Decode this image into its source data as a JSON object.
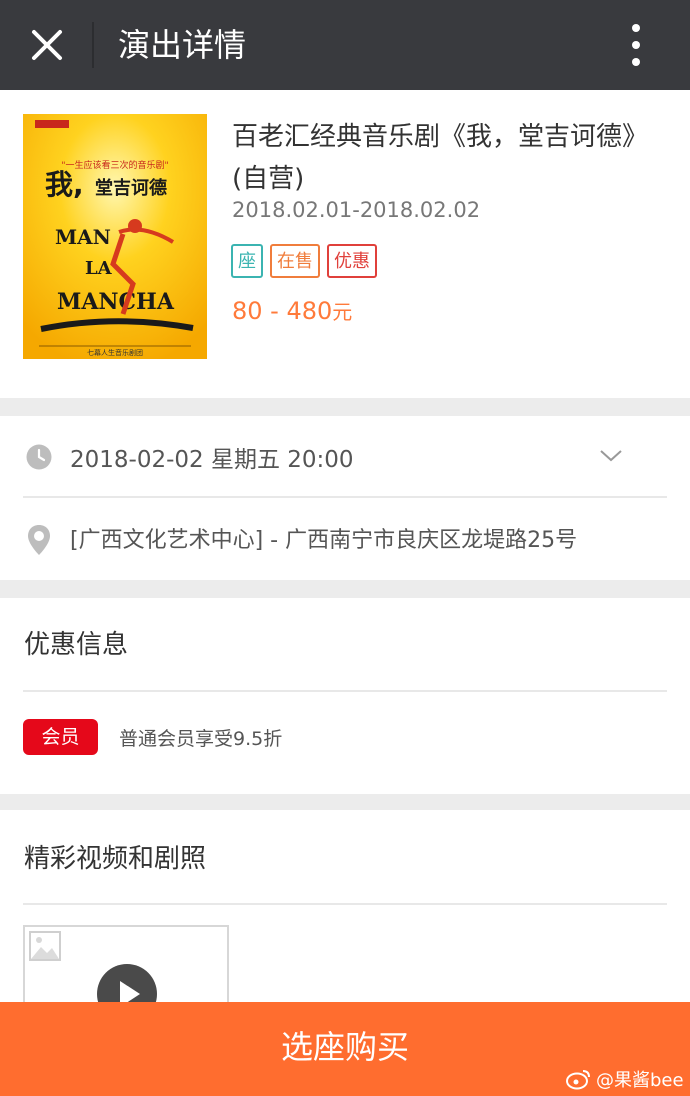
{
  "header": {
    "title": "演出详情"
  },
  "show": {
    "poster": {
      "cn_title_part1": "我,",
      "cn_title_part2": "堂吉诃德",
      "en_line1": "MAN",
      "en_line2": "LA",
      "en_line3": "MANCHA",
      "top_quote": "\"一生应该看三次的音乐剧\"",
      "bottom_credit": "七幕人生音乐剧团"
    },
    "title": "百老汇经典音乐剧《我，堂吉诃德》(自营)",
    "dates": "2018.02.01-2018.02.02",
    "tags": {
      "seat": "座",
      "onsale": "在售",
      "discount": "优惠"
    },
    "price_range": "80 - 480",
    "price_unit": "元"
  },
  "session": {
    "datetime": "2018-02-02 星期五 20:00"
  },
  "venue": {
    "text": "[广西文化艺术中心]  -  广西南宁市良庆区龙堤路25号"
  },
  "offers": {
    "title": "优惠信息",
    "member_badge": "会员",
    "member_text": "普通会员享受9.5折"
  },
  "media": {
    "title": "精彩视频和剧照"
  },
  "buy": {
    "label": "选座购买"
  },
  "watermark": {
    "text": "@果酱bee"
  },
  "colors": {
    "accent": "#ff6d2f",
    "price": "#ff7a3a",
    "topbar": "#393a3e"
  }
}
